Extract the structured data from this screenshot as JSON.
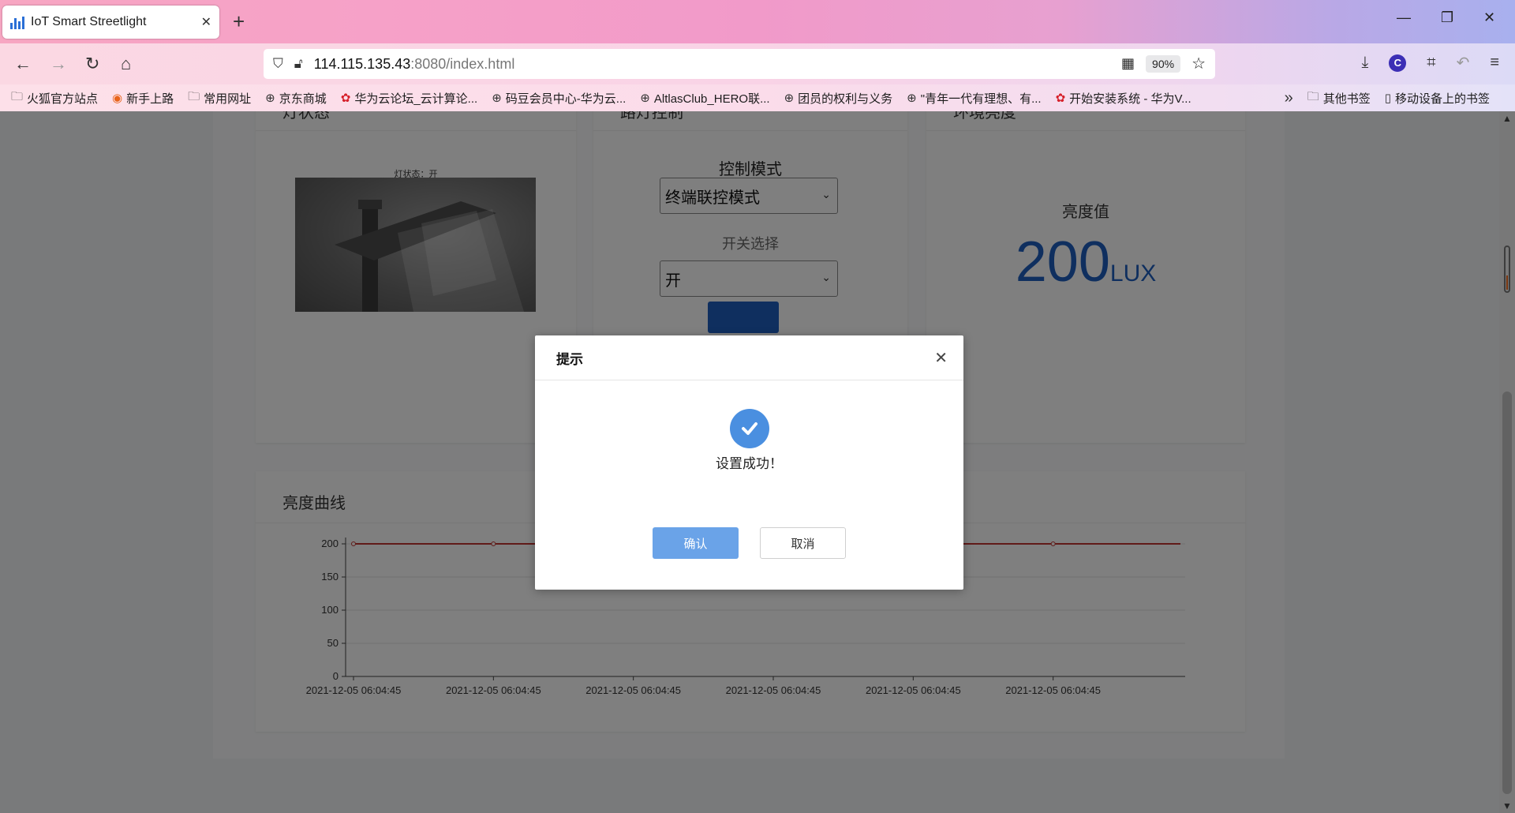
{
  "browser": {
    "tab_title": "IoT Smart Streetlight",
    "url_host": "114.115.135.43",
    "url_path": ":8080/index.html",
    "zoom": "90%",
    "avatar_letter": "C",
    "bookmarks": [
      {
        "icon": "folder-icon",
        "label": "火狐官方站点"
      },
      {
        "icon": "firefox-icon",
        "label": "新手上路"
      },
      {
        "icon": "folder-icon",
        "label": "常用网址"
      },
      {
        "icon": "globe-icon",
        "label": "京东商城"
      },
      {
        "icon": "huawei-icon",
        "label": "华为云论坛_云计算论..."
      },
      {
        "icon": "globe-icon",
        "label": "码豆会员中心-华为云..."
      },
      {
        "icon": "globe-icon",
        "label": "AltlasClub_HERO联..."
      },
      {
        "icon": "globe-icon",
        "label": "团员的权利与义务"
      },
      {
        "icon": "globe-icon",
        "label": "\"青年一代有理想、有..."
      },
      {
        "icon": "huawei-icon",
        "label": "开始安装系统 - 华为V..."
      }
    ],
    "bookmarks_right": [
      {
        "icon": "folder-icon",
        "label": "其他书签"
      },
      {
        "icon": "mobile-icon",
        "label": "移动设备上的书签"
      }
    ]
  },
  "page": {
    "lamp_panel": {
      "title": "灯状态",
      "status_label": "灯状态：开"
    },
    "control_panel": {
      "title": "路灯控制",
      "mode_title": "控制模式",
      "mode_value": "终端联控模式",
      "switch_title": "开关选择",
      "switch_value": "开"
    },
    "env_panel": {
      "title": "环境亮度",
      "label": "亮度值",
      "value": "200",
      "unit": "LUX"
    },
    "chart_panel": {
      "title": "亮度曲线"
    }
  },
  "chart_data": {
    "type": "line",
    "x": [
      "2021-12-05 06:04:45",
      "2021-12-05 06:04:45",
      "2021-12-05 06:04:45",
      "2021-12-05 06:04:45",
      "2021-12-05 06:04:45",
      "2021-12-05 06:04:45"
    ],
    "series": [
      {
        "values": [
          200,
          200,
          200,
          200,
          200,
          200
        ],
        "color": "#c23531"
      }
    ],
    "ylim": [
      0,
      200
    ],
    "yticks": [
      "0",
      "50",
      "100",
      "150",
      "200"
    ],
    "grid": true
  },
  "modal": {
    "title": "提示",
    "message": "设置成功！",
    "confirm_label": "确认",
    "cancel_label": "取消"
  }
}
